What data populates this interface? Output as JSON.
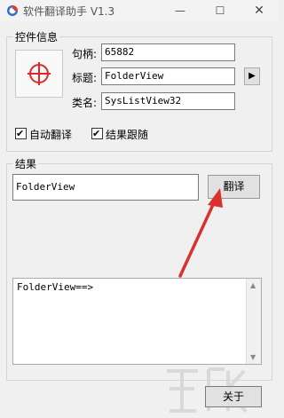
{
  "window": {
    "title": "软件翻译助手 V1.3",
    "minimize_glyph": "—",
    "maximize_glyph": "☐",
    "close_glyph": "✕"
  },
  "control_info": {
    "group_label": "控件信息",
    "handle_label": "句柄:",
    "handle_value": "65882",
    "caption_label": "标题:",
    "caption_value": "FolderView",
    "class_label": "类名:",
    "class_value": "SysListView32",
    "arrow_button_glyph": "▶"
  },
  "options": {
    "auto_translate_label": "自动翻译",
    "auto_translate_checked": true,
    "follow_result_label": "结果跟随",
    "follow_result_checked": true
  },
  "result": {
    "group_label": "结果",
    "input_value": "FolderView",
    "translate_button": "翻译",
    "output_text": "FolderView==>"
  },
  "footer": {
    "close_button": "关于"
  },
  "icons": {
    "app": "app-logo-icon",
    "crosshair": "crosshair-target-icon",
    "annotation_arrow_color": "#d9322e"
  }
}
